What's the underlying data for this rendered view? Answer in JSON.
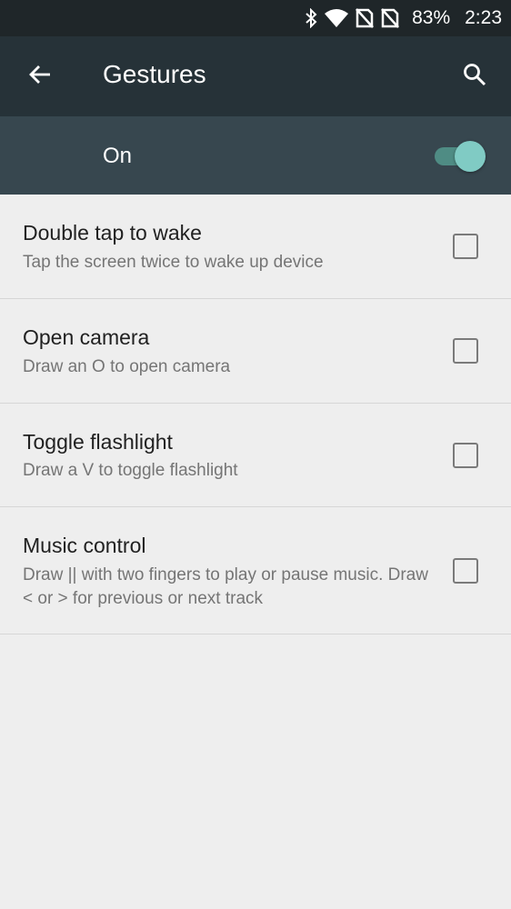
{
  "status_bar": {
    "icons": [
      "bluetooth-icon",
      "wifi-icon",
      "no-sim-icon",
      "no-sim-icon"
    ],
    "battery": "83%",
    "time": "2:23"
  },
  "toolbar": {
    "title": "Gestures",
    "back_icon": "arrow-left-icon",
    "search_icon": "search-icon"
  },
  "master_switch": {
    "label": "On",
    "checked": true,
    "accent": "#80cbc4"
  },
  "gestures": [
    {
      "title": "Double tap to wake",
      "summary": "Tap the screen twice to wake up device",
      "checked": false
    },
    {
      "title": "Open camera",
      "summary": "Draw an O to open camera",
      "checked": false
    },
    {
      "title": "Toggle flashlight",
      "summary": "Draw a V to toggle flashlight",
      "checked": false
    },
    {
      "title": "Music control",
      "summary": "Draw || with two fingers to play or pause music. Draw < or > for previous or next track",
      "checked": false
    }
  ]
}
